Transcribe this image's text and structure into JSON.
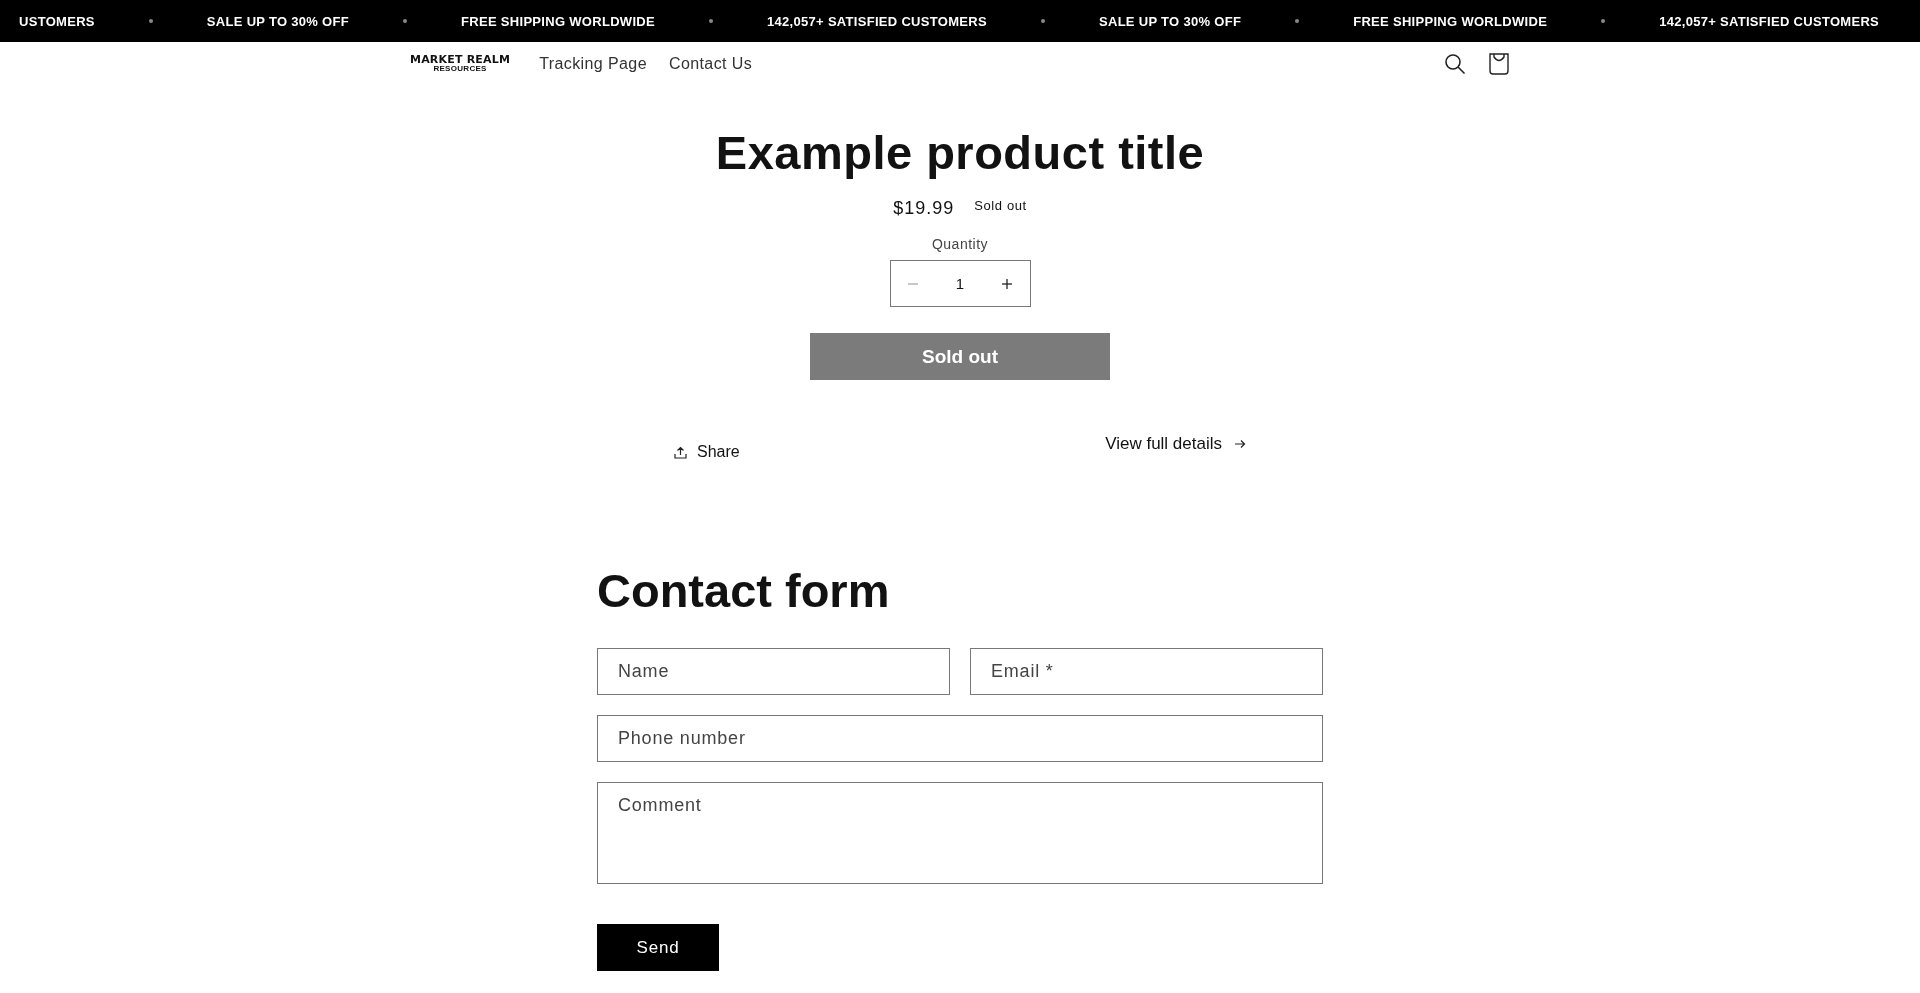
{
  "announcement_bar": {
    "items": [
      "USTOMERS",
      "SALE UP TO 30% OFF",
      "FREE SHIPPING WORLDWIDE",
      "142,057+ SATISFIED CUSTOMERS",
      "SALE UP TO 30% OFF",
      "FREE SHIPPING WORLDWIDE",
      "142,057+ SATISFIED CUSTOMERS"
    ]
  },
  "header": {
    "logo": {
      "name": "MARKET REALM",
      "tagline": "RESOURCES"
    },
    "nav": [
      "Tracking Page",
      "Contact Us"
    ]
  },
  "product": {
    "title": "Example product title",
    "price": "$19.99",
    "badge": "Sold out",
    "quantity": {
      "label": "Quantity",
      "value": "1",
      "decrease_disabled": true
    },
    "add_button": {
      "label": "Sold out",
      "disabled": true
    },
    "share": "Share",
    "details_link": "View full details"
  },
  "contact_form": {
    "title": "Contact form",
    "fields": [
      {
        "placeholder": "Name",
        "kind": "input"
      },
      {
        "placeholder": "Email *",
        "kind": "input"
      },
      {
        "placeholder": "Phone number",
        "kind": "input"
      },
      {
        "placeholder": "Comment",
        "kind": "textarea"
      }
    ],
    "submit": "Send"
  }
}
